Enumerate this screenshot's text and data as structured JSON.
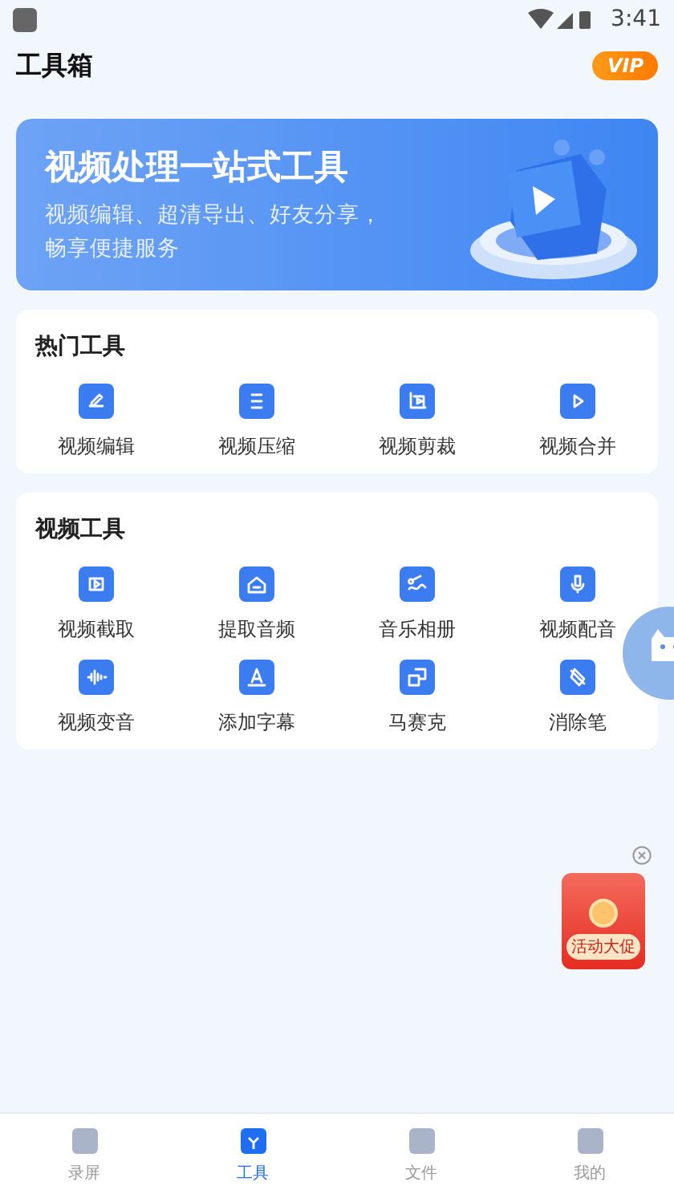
{
  "status_bar": {
    "time": "3:41"
  },
  "header": {
    "title": "工具箱",
    "vip_badge": "VIP"
  },
  "banner": {
    "title": "视频处理一站式工具",
    "subtitle": "视频编辑、超清导出、好友分享，畅享便捷服务",
    "kind": "picture"
  },
  "sections": [
    {
      "title": "热门工具",
      "tools": [
        {
          "label": "视频编辑"
        },
        {
          "label": "视频压缩"
        },
        {
          "label": "视频剪裁"
        },
        {
          "label": "视频合并"
        }
      ]
    },
    {
      "title": "视频工具",
      "tools": [
        {
          "label": "视频截取"
        },
        {
          "label": "提取音频"
        },
        {
          "label": "音乐相册"
        },
        {
          "label": "视频配音"
        },
        {
          "label": "视频变音"
        },
        {
          "label": "添加字幕"
        },
        {
          "label": "马赛克"
        },
        {
          "label": "消除笔"
        }
      ]
    }
  ],
  "promo": {
    "label": "活动大促"
  },
  "bottom_nav": [
    {
      "label": "录屏",
      "selected": false
    },
    {
      "label": "工具",
      "selected": true
    },
    {
      "label": "文件",
      "selected": false
    },
    {
      "label": "我的",
      "selected": false
    }
  ]
}
